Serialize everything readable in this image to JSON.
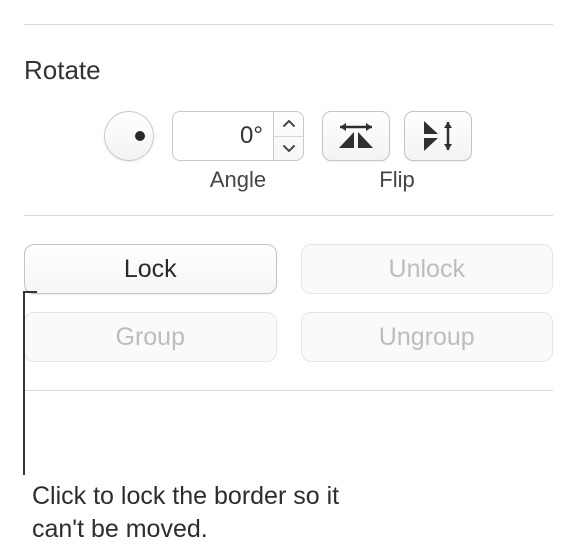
{
  "section": {
    "title": "Rotate",
    "angle": {
      "value": "0°",
      "label": "Angle"
    },
    "flip": {
      "label": "Flip"
    }
  },
  "buttons": {
    "lock": "Lock",
    "unlock": "Unlock",
    "group": "Group",
    "ungroup": "Ungroup"
  },
  "caption": "Click to lock the border so it can't be moved."
}
